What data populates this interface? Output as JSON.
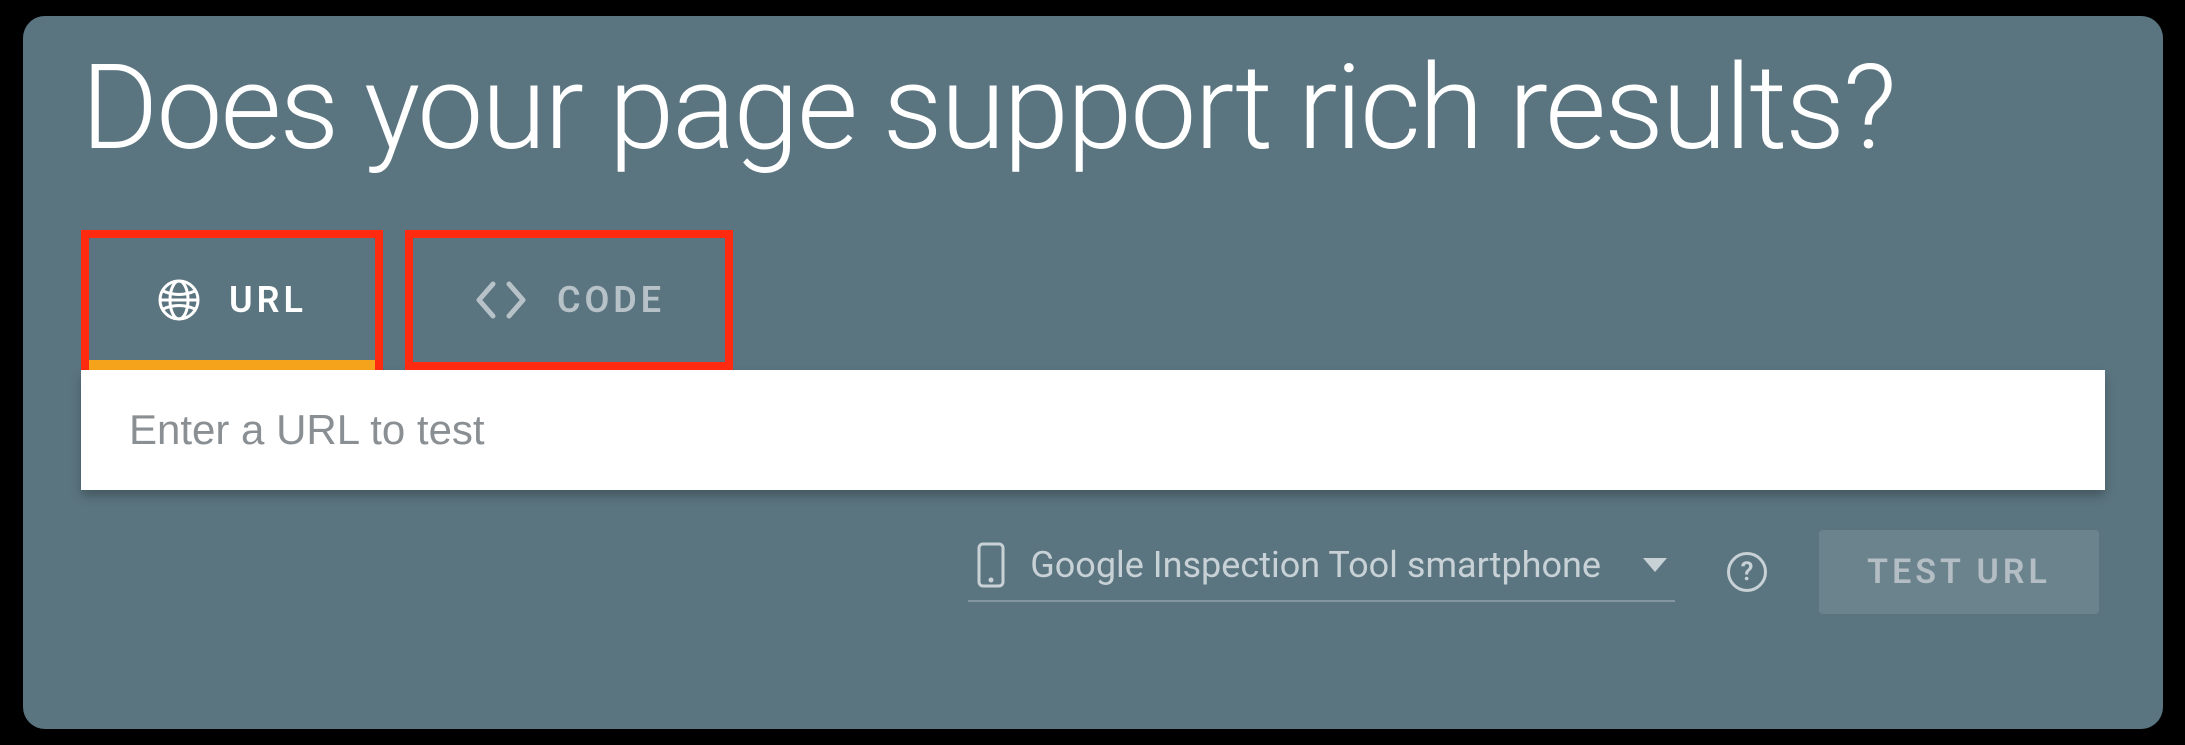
{
  "heading": "Does your page support rich results?",
  "tabs": {
    "url": {
      "label": "URL",
      "active": true
    },
    "code": {
      "label": "CODE",
      "active": false
    }
  },
  "input": {
    "placeholder": "Enter a URL to test",
    "value": ""
  },
  "crawler": {
    "selected": "Google Inspection Tool smartphone"
  },
  "buttons": {
    "test": "TEST URL"
  },
  "help_glyph": "?"
}
